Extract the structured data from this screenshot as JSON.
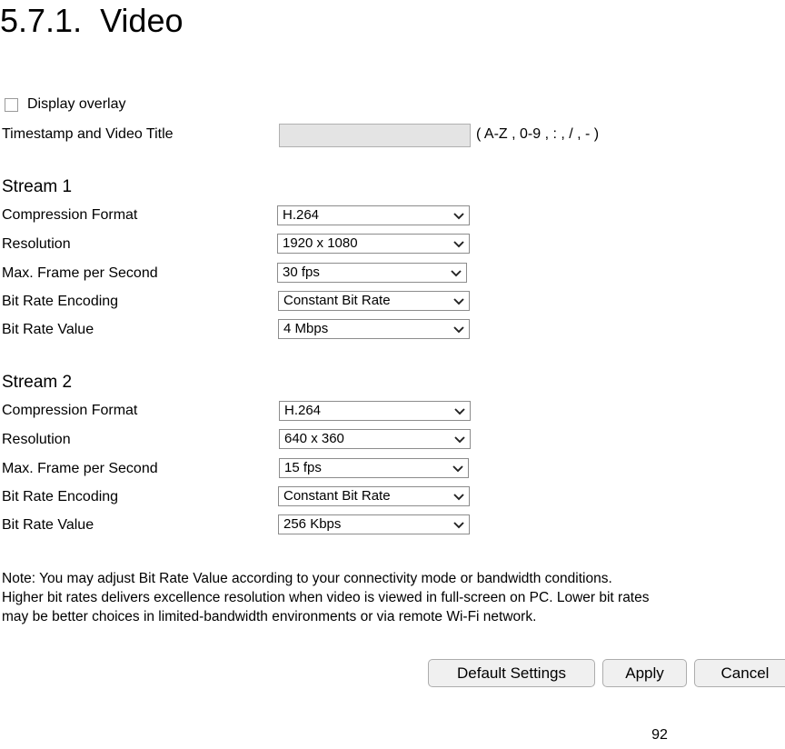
{
  "heading": "5.7.1.  Video",
  "overlay": {
    "checkbox_label": "Display overlay",
    "checked": false
  },
  "timestamp_field": {
    "label": "Timestamp and Video Title",
    "value": "",
    "placeholder": "",
    "hint": "( A-Z , 0-9 , : , / , - )"
  },
  "streams": [
    {
      "heading": "Stream 1",
      "rows": [
        {
          "label": "Compression Format",
          "value": "H.264"
        },
        {
          "label": "Resolution",
          "value": "1920 x 1080"
        },
        {
          "label": "Max. Frame per Second",
          "value": "30 fps"
        },
        {
          "label": "Bit Rate Encoding",
          "value": "Constant Bit Rate"
        },
        {
          "label": "Bit Rate Value",
          "value": "4 Mbps"
        }
      ]
    },
    {
      "heading": "Stream 2",
      "rows": [
        {
          "label": "Compression Format",
          "value": "H.264"
        },
        {
          "label": "Resolution",
          "value": "640 x 360"
        },
        {
          "label": "Max. Frame per Second",
          "value": "15 fps"
        },
        {
          "label": "Bit Rate Encoding",
          "value": "Constant Bit Rate"
        },
        {
          "label": "Bit Rate Value",
          "value": "256 Kbps"
        }
      ]
    }
  ],
  "note": {
    "line1": "Note: You may adjust Bit Rate Value according to your connectivity mode or bandwidth conditions.",
    "line2": "Higher bit rates delivers excellence resolution when video is viewed in full-screen on PC. Lower bit rates",
    "line3": "may be better choices in limited-bandwidth environments or via remote Wi-Fi network."
  },
  "buttons": {
    "default_settings": "Default Settings",
    "apply": "Apply",
    "cancel": "Cancel"
  },
  "page_number": "92",
  "colors": {
    "text": "#000000",
    "input_fill": "#e4e4e4",
    "input_border": "#b0b0b0",
    "select_border": "#8c8c8c",
    "button_fill": "#f0f0f0",
    "button_border": "#adadad"
  }
}
